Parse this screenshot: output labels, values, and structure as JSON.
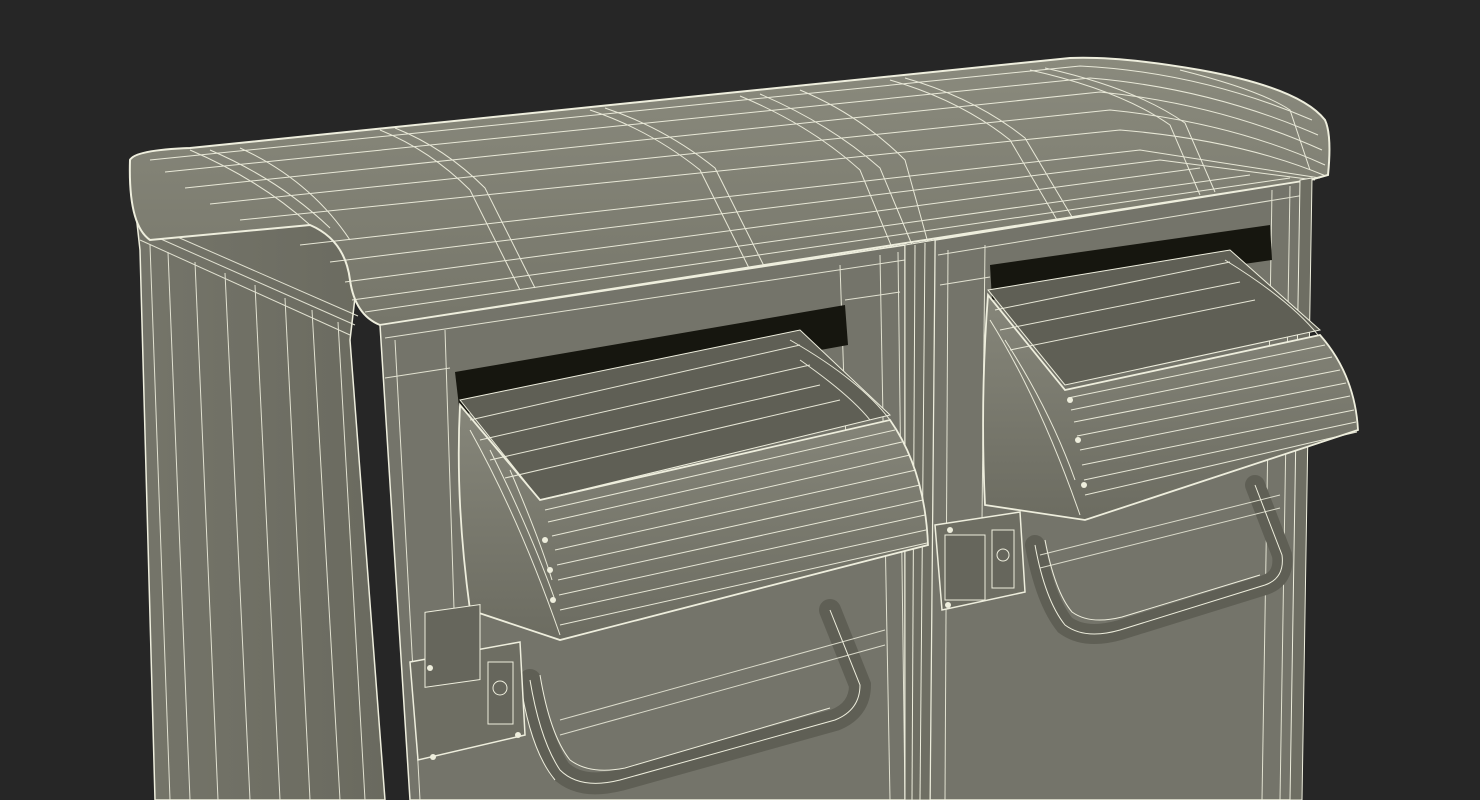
{
  "scene": {
    "background_color": "#262626",
    "subject": "wireframe-render-double-mailbox",
    "body_color": "#7b7b6e",
    "body_dark_color": "#6b6b60",
    "wire_color": "#eeeedd",
    "slot_color": "#16160f"
  }
}
